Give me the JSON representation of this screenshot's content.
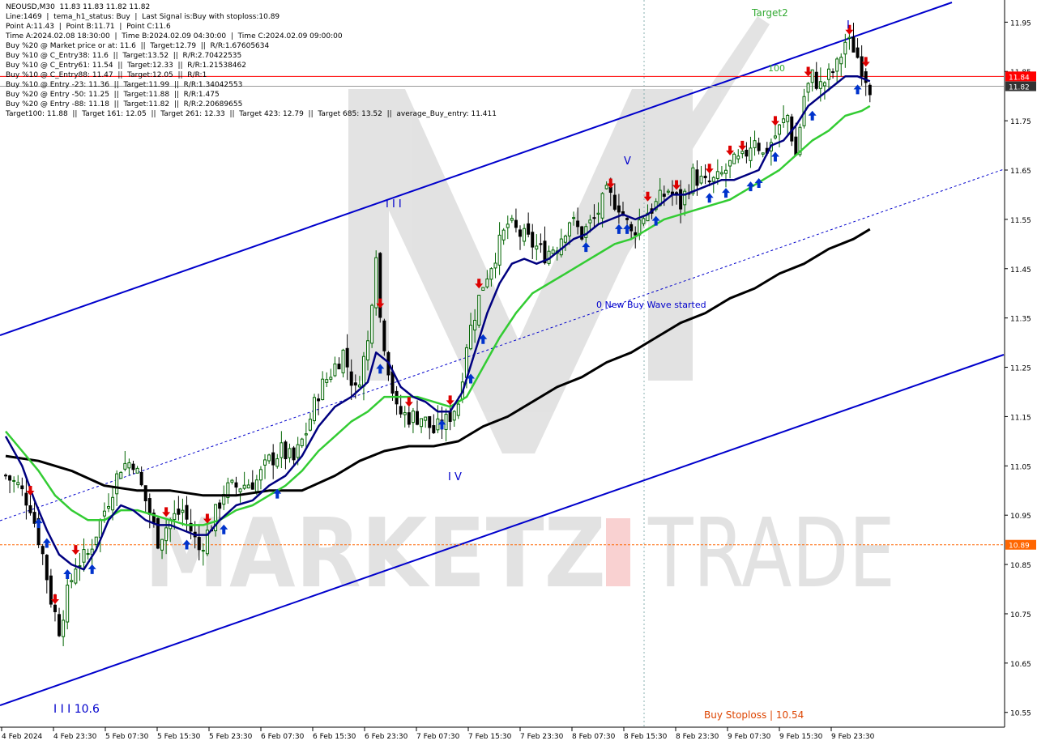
{
  "header": {
    "symbol_line": "NEOUSD,M30  11.83 11.83 11.82 11.82",
    "info_lines": [
      "Line:1469  |  tema_h1_status: Buy  |  Last Signal is:Buy with stoploss:10.89",
      "Point A:11.43  |  Point B:11.71  |  Point C:11.6",
      "Time A:2024.02.08 18:30:00  |  Time B:2024.02.09 04:30:00  |  Time C:2024.02.09 09:00:00",
      "Buy %20 @ Market price or at: 11.6  ||  Target:12.79  ||  R/R:1.67605634",
      "Buy %10 @ C_Entry38: 11.6  ||  Target:13.52  ||  R/R:2.70422535",
      "Buy %10 @ C_Entry61: 11.54  ||  Target:12.33  ||  R/R:1.21538462",
      "Buy %10 @ C_Entry88: 11.47  ||  Target:12.05  ||  R/R:1",
      "Buy %10 @ Entry -23: 11.36  ||  Target:11.99  ||  R/R:1.34042553",
      "Buy %20 @ Entry -50: 11.25  ||  Target:11.88  ||  R/R:1.475",
      "Buy %20 @ Entry -88: 11.18  ||  Target:11.82  ||  R/R:2.20689655",
      "Target100: 11.88  ||  Target 161: 12.05  ||  Target 261: 12.33  ||  Target 423: 12.79  ||  Target 685: 13.52  ||  average_Buy_entry: 11.411"
    ]
  },
  "watermark": {
    "brand_left": "MARKETZ",
    "brand_mid": "I",
    "brand_right": "TRADE"
  },
  "annotations": {
    "target2": "Target2",
    "target100": "100",
    "wave_label": "0 New Buy Wave started",
    "stoploss": "Buy Stoploss | 10.54",
    "wave_i": "I",
    "wave_iii": "I I I",
    "wave_iv": "I V",
    "wave_v": "V",
    "wave_low": "I I I 10.6"
  },
  "colors": {
    "channel": "#0000cc",
    "tema_fast": "#000080",
    "ma_green": "#33cc33",
    "ma_black": "#000000",
    "bull_candle": "#006400",
    "bear_candle": "#000000",
    "buy_arrow": "#0033cc",
    "sell_arrow": "#dd0000",
    "price_line_red": "#ff0000",
    "stoploss_line": "#ff6600",
    "label_green": "#33aa33",
    "label_stop": "#dd4400"
  },
  "chart_data": {
    "type": "candlestick",
    "symbol": "NEOUSD",
    "timeframe": "M30",
    "ylim": [
      10.52,
      11.99
    ],
    "y_ticks": [
      "11.95",
      "11.85",
      "11.75",
      "11.65",
      "11.55",
      "11.45",
      "11.35",
      "11.25",
      "11.15",
      "11.05",
      "10.95",
      "10.85",
      "10.75",
      "10.65",
      "10.55"
    ],
    "x_ticks": [
      "4 Feb 2024",
      "4 Feb 23:30",
      "5 Feb 07:30",
      "5 Feb 15:30",
      "5 Feb 23:30",
      "6 Feb 07:30",
      "6 Feb 15:30",
      "6 Feb 23:30",
      "7 Feb 07:30",
      "7 Feb 15:30",
      "7 Feb 23:30",
      "8 Feb 07:30",
      "8 Feb 15:30",
      "8 Feb 23:30",
      "9 Feb 07:30",
      "9 Feb 15:30",
      "9 Feb 23:30"
    ],
    "current_price": {
      "value": 11.84,
      "label": "11.84"
    },
    "bid_price": {
      "value": 11.82,
      "label": "11.82"
    },
    "stoploss_price": {
      "value": 10.89,
      "label": "10.89"
    },
    "close_path": [
      [
        0,
        11.03
      ],
      [
        3,
        11.01
      ],
      [
        6,
        10.97
      ],
      [
        9,
        10.87
      ],
      [
        11,
        10.78
      ],
      [
        13,
        10.72
      ],
      [
        15,
        10.79
      ],
      [
        17,
        10.85
      ],
      [
        20,
        10.87
      ],
      [
        24,
        10.96
      ],
      [
        28,
        11.05
      ],
      [
        31,
        11.06
      ],
      [
        34,
        10.98
      ],
      [
        37,
        10.9
      ],
      [
        40,
        10.94
      ],
      [
        43,
        10.96
      ],
      [
        47,
        10.88
      ],
      [
        50,
        10.93
      ],
      [
        53,
        11.0
      ],
      [
        57,
        11.01
      ],
      [
        61,
        11.02
      ],
      [
        64,
        11.06
      ],
      [
        67,
        11.08
      ],
      [
        70,
        11.06
      ],
      [
        73,
        11.12
      ],
      [
        76,
        11.2
      ],
      [
        79,
        11.24
      ],
      [
        82,
        11.28
      ],
      [
        85,
        11.2
      ],
      [
        88,
        11.3
      ],
      [
        90,
        11.49
      ],
      [
        91,
        11.35
      ],
      [
        93,
        11.25
      ],
      [
        95,
        11.16
      ],
      [
        98,
        11.15
      ],
      [
        101,
        11.15
      ],
      [
        104,
        11.12
      ],
      [
        107,
        11.14
      ],
      [
        110,
        11.18
      ],
      [
        112,
        11.3
      ],
      [
        114,
        11.36
      ],
      [
        116,
        11.42
      ],
      [
        118,
        11.46
      ],
      [
        120,
        11.5
      ],
      [
        122,
        11.54
      ],
      [
        125,
        11.52
      ],
      [
        128,
        11.5
      ],
      [
        131,
        11.48
      ],
      [
        134,
        11.5
      ],
      [
        137,
        11.55
      ],
      [
        140,
        11.52
      ],
      [
        143,
        11.55
      ],
      [
        146,
        11.6
      ],
      [
        149,
        11.58
      ],
      [
        152,
        11.52
      ],
      [
        155,
        11.56
      ],
      [
        158,
        11.58
      ],
      [
        161,
        11.61
      ],
      [
        164,
        11.58
      ],
      [
        167,
        11.64
      ],
      [
        170,
        11.62
      ],
      [
        173,
        11.63
      ],
      [
        176,
        11.66
      ],
      [
        179,
        11.67
      ],
      [
        182,
        11.72
      ],
      [
        184,
        11.68
      ],
      [
        187,
        11.72
      ],
      [
        190,
        11.76
      ],
      [
        192,
        11.68
      ],
      [
        194,
        11.8
      ],
      [
        196,
        11.84
      ],
      [
        198,
        11.82
      ],
      [
        200,
        11.84
      ],
      [
        202,
        11.86
      ],
      [
        204,
        11.91
      ],
      [
        206,
        11.9
      ],
      [
        208,
        11.86
      ],
      [
        209,
        11.84
      ],
      [
        210,
        11.82
      ]
    ],
    "tema_h1_path": [
      [
        0,
        11.11
      ],
      [
        4,
        11.05
      ],
      [
        7,
        10.98
      ],
      [
        10,
        10.92
      ],
      [
        13,
        10.87
      ],
      [
        16,
        10.85
      ],
      [
        19,
        10.84
      ],
      [
        22,
        10.88
      ],
      [
        25,
        10.94
      ],
      [
        28,
        10.97
      ],
      [
        31,
        10.96
      ],
      [
        34,
        10.94
      ],
      [
        37,
        10.93
      ],
      [
        40,
        10.93
      ],
      [
        43,
        10.92
      ],
      [
        46,
        10.91
      ],
      [
        49,
        10.91
      ],
      [
        52,
        10.94
      ],
      [
        56,
        10.97
      ],
      [
        60,
        10.98
      ],
      [
        64,
        11.01
      ],
      [
        68,
        11.03
      ],
      [
        72,
        11.07
      ],
      [
        76,
        11.13
      ],
      [
        80,
        11.17
      ],
      [
        84,
        11.19
      ],
      [
        88,
        11.22
      ],
      [
        90,
        11.28
      ],
      [
        93,
        11.26
      ],
      [
        96,
        11.21
      ],
      [
        99,
        11.19
      ],
      [
        102,
        11.18
      ],
      [
        105,
        11.16
      ],
      [
        108,
        11.16
      ],
      [
        111,
        11.2
      ],
      [
        114,
        11.28
      ],
      [
        117,
        11.36
      ],
      [
        120,
        11.42
      ],
      [
        123,
        11.46
      ],
      [
        126,
        11.47
      ],
      [
        129,
        11.46
      ],
      [
        132,
        11.47
      ],
      [
        135,
        11.49
      ],
      [
        138,
        11.51
      ],
      [
        141,
        11.52
      ],
      [
        144,
        11.54
      ],
      [
        147,
        11.55
      ],
      [
        150,
        11.56
      ],
      [
        153,
        11.55
      ],
      [
        156,
        11.56
      ],
      [
        159,
        11.58
      ],
      [
        162,
        11.6
      ],
      [
        165,
        11.6
      ],
      [
        168,
        11.61
      ],
      [
        171,
        11.62
      ],
      [
        174,
        11.63
      ],
      [
        177,
        11.63
      ],
      [
        180,
        11.64
      ],
      [
        183,
        11.65
      ],
      [
        186,
        11.7
      ],
      [
        189,
        11.71
      ],
      [
        192,
        11.74
      ],
      [
        195,
        11.78
      ],
      [
        198,
        11.8
      ],
      [
        201,
        11.82
      ],
      [
        204,
        11.84
      ],
      [
        207,
        11.84
      ],
      [
        210,
        11.83
      ]
    ],
    "ma_green_path": [
      [
        0,
        11.12
      ],
      [
        4,
        11.08
      ],
      [
        8,
        11.04
      ],
      [
        12,
        10.99
      ],
      [
        16,
        10.96
      ],
      [
        20,
        10.94
      ],
      [
        24,
        10.94
      ],
      [
        28,
        10.96
      ],
      [
        32,
        10.96
      ],
      [
        36,
        10.95
      ],
      [
        40,
        10.94
      ],
      [
        44,
        10.93
      ],
      [
        48,
        10.93
      ],
      [
        52,
        10.94
      ],
      [
        56,
        10.96
      ],
      [
        60,
        10.97
      ],
      [
        64,
        10.99
      ],
      [
        68,
        11.01
      ],
      [
        72,
        11.04
      ],
      [
        76,
        11.08
      ],
      [
        80,
        11.11
      ],
      [
        84,
        11.14
      ],
      [
        88,
        11.16
      ],
      [
        92,
        11.19
      ],
      [
        96,
        11.19
      ],
      [
        100,
        11.19
      ],
      [
        104,
        11.18
      ],
      [
        108,
        11.17
      ],
      [
        112,
        11.19
      ],
      [
        116,
        11.25
      ],
      [
        120,
        11.31
      ],
      [
        124,
        11.36
      ],
      [
        128,
        11.4
      ],
      [
        132,
        11.42
      ],
      [
        136,
        11.44
      ],
      [
        140,
        11.46
      ],
      [
        144,
        11.48
      ],
      [
        148,
        11.5
      ],
      [
        152,
        11.51
      ],
      [
        156,
        11.53
      ],
      [
        160,
        11.55
      ],
      [
        164,
        11.56
      ],
      [
        168,
        11.57
      ],
      [
        172,
        11.58
      ],
      [
        176,
        11.59
      ],
      [
        180,
        11.61
      ],
      [
        184,
        11.63
      ],
      [
        188,
        11.65
      ],
      [
        192,
        11.68
      ],
      [
        196,
        11.71
      ],
      [
        200,
        11.73
      ],
      [
        204,
        11.76
      ],
      [
        208,
        11.77
      ],
      [
        210,
        11.78
      ]
    ],
    "ma_black_path": [
      [
        0,
        11.07
      ],
      [
        8,
        11.06
      ],
      [
        16,
        11.04
      ],
      [
        24,
        11.01
      ],
      [
        32,
        11.0
      ],
      [
        40,
        11.0
      ],
      [
        48,
        10.99
      ],
      [
        56,
        10.99
      ],
      [
        64,
        11.0
      ],
      [
        72,
        11.0
      ],
      [
        80,
        11.03
      ],
      [
        86,
        11.06
      ],
      [
        92,
        11.08
      ],
      [
        98,
        11.09
      ],
      [
        104,
        11.09
      ],
      [
        110,
        11.1
      ],
      [
        116,
        11.13
      ],
      [
        122,
        11.15
      ],
      [
        128,
        11.18
      ],
      [
        134,
        11.21
      ],
      [
        140,
        11.23
      ],
      [
        146,
        11.26
      ],
      [
        152,
        11.28
      ],
      [
        158,
        11.31
      ],
      [
        164,
        11.34
      ],
      [
        170,
        11.36
      ],
      [
        176,
        11.39
      ],
      [
        182,
        11.41
      ],
      [
        188,
        11.44
      ],
      [
        194,
        11.46
      ],
      [
        200,
        11.49
      ],
      [
        206,
        11.51
      ],
      [
        210,
        11.53
      ]
    ]
  }
}
